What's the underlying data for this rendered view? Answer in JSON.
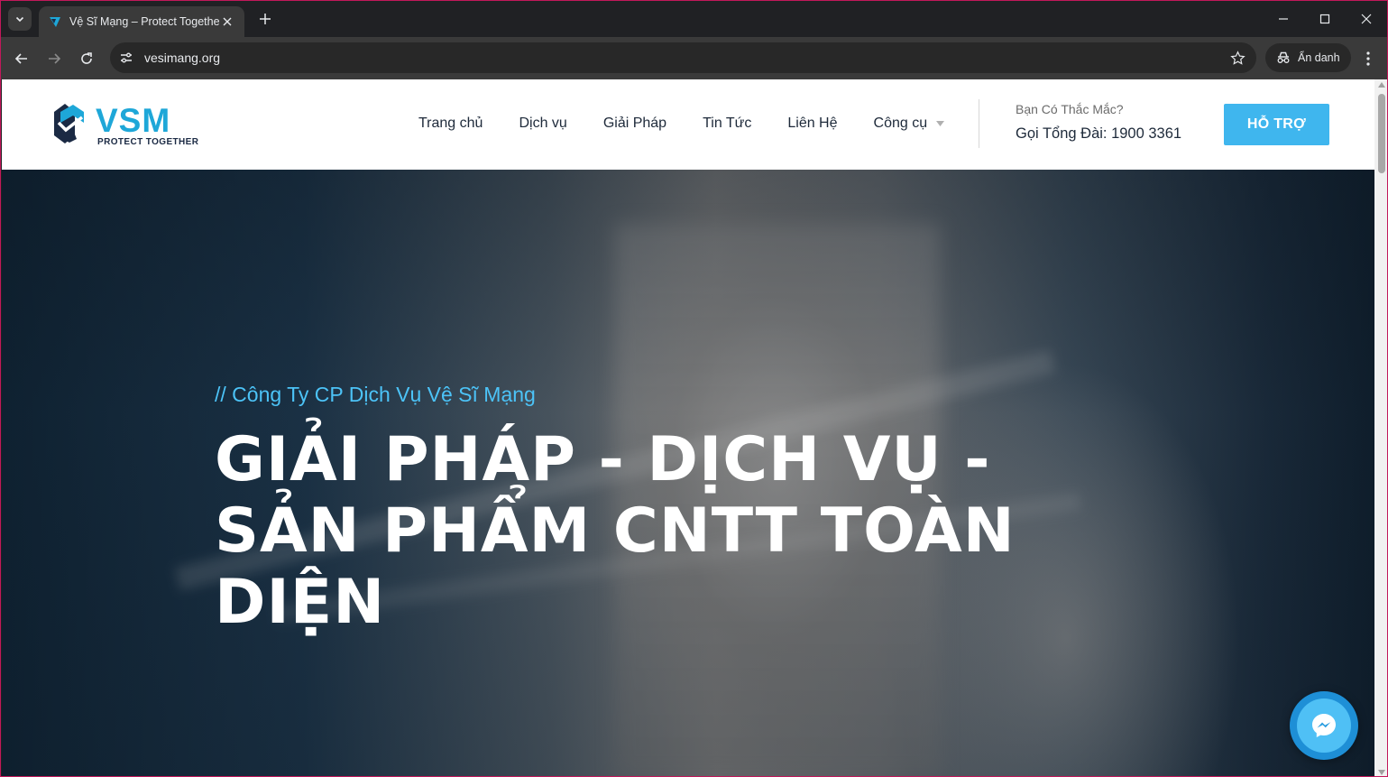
{
  "browser": {
    "tab_title": "Vệ Sĩ Mạng – Protect Together",
    "url": "vesimang.org",
    "incognito_label": "Ẩn danh"
  },
  "site": {
    "logo_text": "VSM",
    "logo_tagline": "PROTECT TOGETHER",
    "nav": [
      "Trang chủ",
      "Dịch vụ",
      "Giải Pháp",
      "Tin Tức",
      "Liên Hệ",
      "Công cụ"
    ],
    "ask_text": "Bạn Có Thắc Mắc?",
    "hotline": "Gọi Tổng Đài: 1900 3361",
    "support_button": "HỖ TRỢ"
  },
  "hero": {
    "kicker": "// Công Ty CP Dịch Vụ Vệ Sĩ Mạng",
    "headline": "GIẢI PHÁP - DỊCH VỤ - SẢN PHẨM CNTT TOÀN DIỆN"
  },
  "icons": {
    "messenger": "messenger-icon"
  },
  "colors": {
    "accent": "#3fb6ee",
    "kicker": "#4cc3f7",
    "nav_text": "#1e2a3a"
  }
}
